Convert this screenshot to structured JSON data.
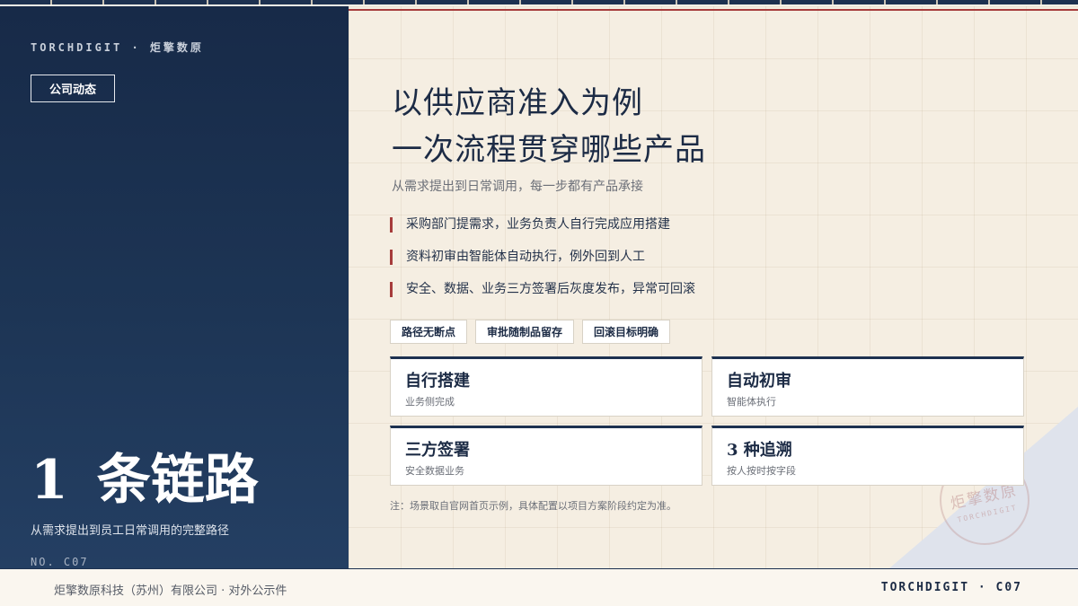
{
  "brand": "TORCHDIGIT · 炬擎数原",
  "section_tag": "公司动态",
  "hero": {
    "number": "1",
    "text": "条链路",
    "subtitle": "从需求提出到员工日常调用的完整路径",
    "page_no": "NO. C07"
  },
  "title": {
    "line1": "以供应商准入为例",
    "line2": "一次流程贯穿哪些产品"
  },
  "subtitle": "从需求提出到日常调用，每一步都有产品承接",
  "bullets": [
    "采购部门提需求，业务负责人自行完成应用搭建",
    "资料初审由智能体自动执行，例外回到人工",
    "安全、数据、业务三方签署后灰度发布，异常可回滚"
  ],
  "chips": [
    "路径无断点",
    "审批随制品留存",
    "回滚目标明确"
  ],
  "cards": [
    {
      "title": "自行搭建",
      "sub": "业务侧完成"
    },
    {
      "title": "自动初审",
      "sub": "智能体执行"
    },
    {
      "title": "三方签署",
      "sub": "安全数据业务"
    },
    {
      "title": "3 种追溯",
      "sub": "按人按时按字段"
    }
  ],
  "note": "注：场景取自官网首页示例，具体配置以项目方案阶段约定为准。",
  "seal": {
    "cn": "炬擎数原",
    "en": "TORCHDIGIT"
  },
  "footer": {
    "left": "炬擎数原科技（苏州）有限公司 · 对外公示件",
    "right": "TORCHDIGIT · C07"
  },
  "colors": {
    "navy": "#1d3150",
    "accent_red": "#a63c3c",
    "background": "#f5eee2"
  }
}
